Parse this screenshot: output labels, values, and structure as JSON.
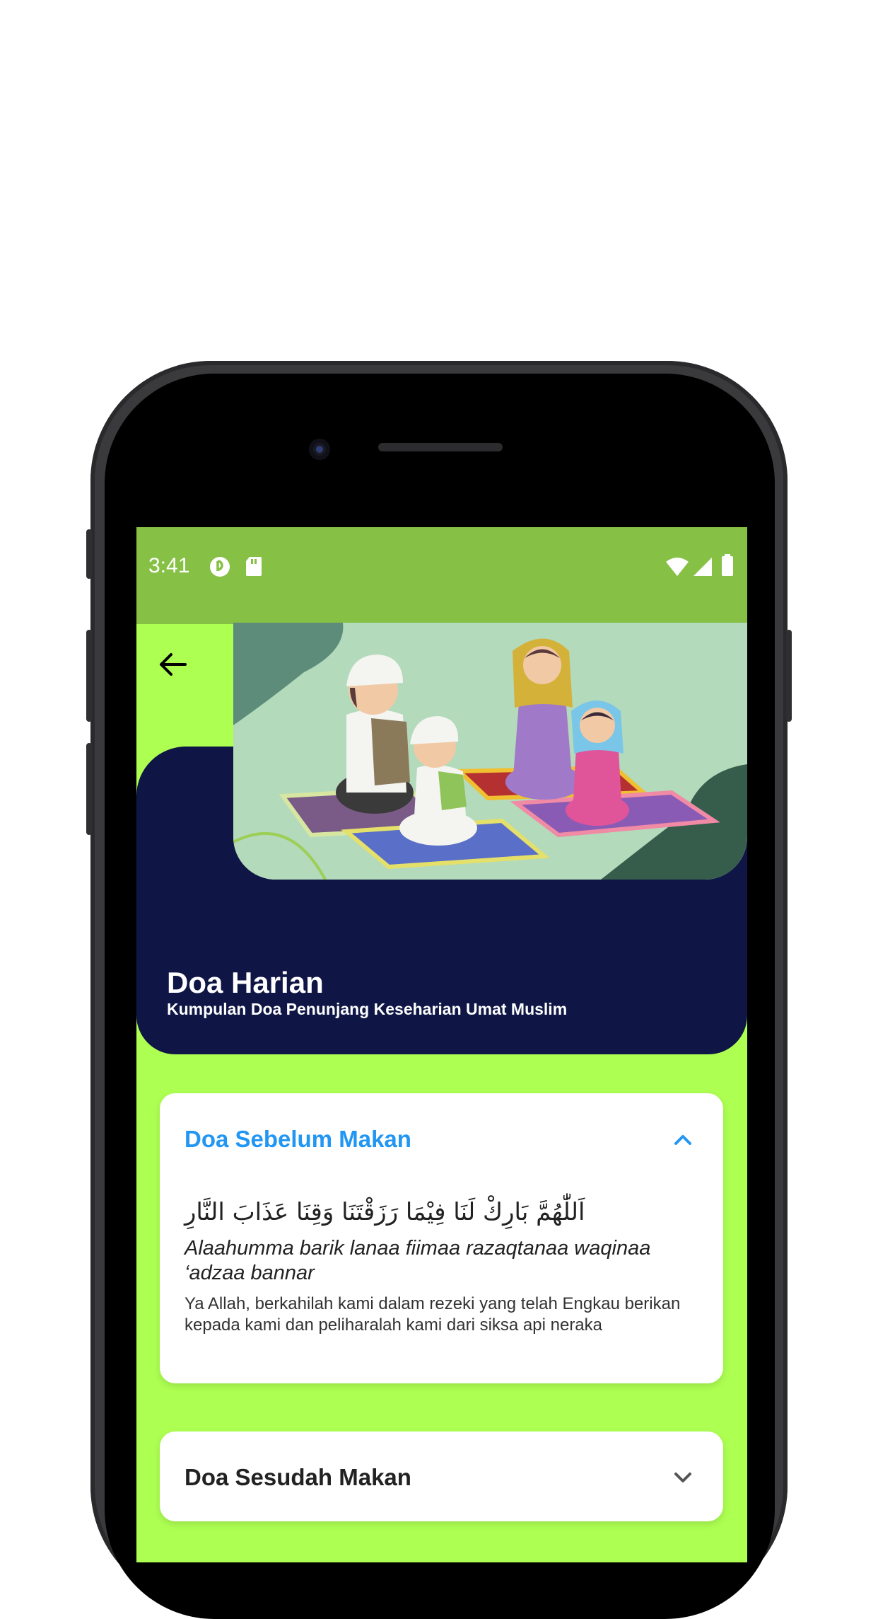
{
  "status": {
    "time": "3:41",
    "left_icons": [
      "app-notification-icon",
      "sd-card-icon"
    ],
    "right_icons": [
      "wifi-icon",
      "signal-icon",
      "battery-icon"
    ]
  },
  "header": {
    "back_icon": "arrow-left-icon",
    "title": "Doa Harian",
    "subtitle": "Kumpulan Doa Penunjang Keseharian Umat Muslim"
  },
  "colors": {
    "status_bar": "#86c045",
    "background": "#adff52",
    "hero_dark": "#0f1645",
    "accent": "#2196f3"
  },
  "prayers": [
    {
      "title": "Doa Sebelum Makan",
      "expanded": true,
      "arabic": "اَللّٰهُمَّ بَارِكْ لَنَا فِيْمَا رَزَقْتَنَا وَقِنَا عَذَابَ النَّارِ",
      "latin": "Alaahumma barik lanaa fiimaa razaqtanaa waqinaa ‘adzaa bannar",
      "meaning": "Ya Allah, berkahilah kami dalam rezeki yang telah Engkau berikan kepada kami dan peliharalah kami dari siksa api neraka",
      "chevron_icon": "chevron-up-icon"
    },
    {
      "title": "Doa Sesudah Makan",
      "expanded": false,
      "chevron_icon": "chevron-down-icon"
    }
  ]
}
